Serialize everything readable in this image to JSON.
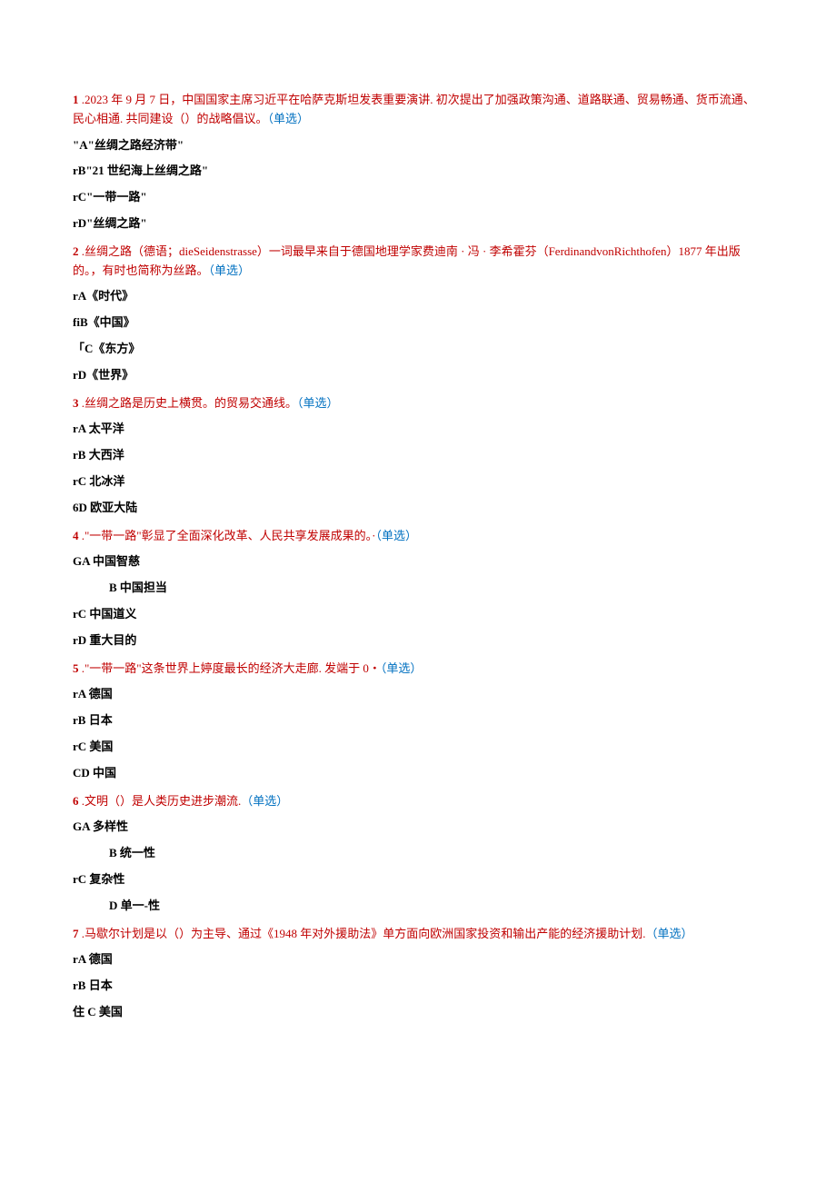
{
  "questions": [
    {
      "num": "1",
      "sep": " .",
      "text": "2023 年 9 月 7 日，中国国家主席习近平在哈萨克斯坦发表重要演讲. 初次提出了加强政策沟通、道路联通、贸易畅通、货币流通、民心相通. 共同建设（）的战略倡议。",
      "hint": "（单选）",
      "options": [
        {
          "pre": "\"A",
          "text": "\"丝绸之路经济带\"",
          "indent": false
        },
        {
          "pre": "rB",
          "text": "\"21 世纪海上丝绸之路\"",
          "indent": false
        },
        {
          "pre": "rC",
          "text": "\"一带一路\"",
          "indent": false
        },
        {
          "pre": "rD",
          "text": "\"丝绸之路\"",
          "indent": false
        }
      ]
    },
    {
      "num": "2",
      "sep": " .",
      "text": "丝绸之路（德语；dieSeidenstrasse）一词最早来自于德国地理学家费迪南 · 冯 · 李希霍芬（FerdinandvonRichthofen）1877 年出版的。，有时也简称为丝路。",
      "hint": "（单选）",
      "options": [
        {
          "pre": "rA",
          "text": "《时代》",
          "indent": false
        },
        {
          "pre": "fiB",
          "text": "《中国》",
          "indent": false
        },
        {
          "pre": "「C",
          "text": "《东方》",
          "indent": false
        },
        {
          "pre": "rD",
          "text": "《世界》",
          "indent": false
        }
      ]
    },
    {
      "num": "3",
      "sep": " .",
      "text": "丝绸之路是历史上横贯。的贸易交通线。",
      "hint": "（单选）",
      "options": [
        {
          "pre": "rA",
          "text": " 太平洋",
          "indent": false
        },
        {
          "pre": "rB",
          "text": " 大西洋",
          "indent": false
        },
        {
          "pre": "rC",
          "text": " 北冰洋",
          "indent": false
        },
        {
          "pre": "6D",
          "text": " 欧亚大陆",
          "indent": false
        }
      ]
    },
    {
      "num": "4",
      "sep": " .",
      "text": "\"一带一路\"彰显了全面深化改革、人民共享发展成果的。·",
      "hint": "（单选）",
      "options": [
        {
          "pre": "GA",
          "text": " 中国智慈",
          "indent": false
        },
        {
          "pre": "B",
          "text": " 中国担当",
          "indent": true
        },
        {
          "pre": "rC",
          "text": " 中国道义",
          "indent": false
        },
        {
          "pre": "rD",
          "text": " 重大目的",
          "indent": false
        }
      ]
    },
    {
      "num": "5",
      "sep": " .",
      "text": "\"一带一路\"这条世界上婷度最长的经济大走廊. 发端于 0・",
      "hint": "（单选）",
      "options": [
        {
          "pre": "rA",
          "text": " 德国",
          "indent": false
        },
        {
          "pre": "rB",
          "text": " 日本",
          "indent": false
        },
        {
          "pre": "rC",
          "text": " 美国",
          "indent": false
        },
        {
          "pre": "CD",
          "text": " 中国",
          "indent": false
        }
      ]
    },
    {
      "num": "6",
      "sep": " .",
      "text": "文明（）是人类历史进步潮流.",
      "hint": "（单选）",
      "options": [
        {
          "pre": "GA",
          "text": " 多样性",
          "indent": false
        },
        {
          "pre": "B",
          "text": " 统一性",
          "indent": true
        },
        {
          "pre": "rC",
          "text": " 复杂性",
          "indent": false
        },
        {
          "pre": "D",
          "text": " 单一-性",
          "indent": true
        }
      ]
    },
    {
      "num": "7",
      "sep": " .",
      "text": "马歇尔计划是以（）为主导、通过《1948 年对外援助法》单方面向欧洲国家投资和输出产能的经济援助计划.",
      "hint": "（单选）",
      "options": [
        {
          "pre": "rA",
          "text": " 德国",
          "indent": false
        },
        {
          "pre": "rB",
          "text": " 日本",
          "indent": false
        },
        {
          "pre": "住 C",
          "text": " 美国",
          "indent": false
        }
      ]
    }
  ]
}
